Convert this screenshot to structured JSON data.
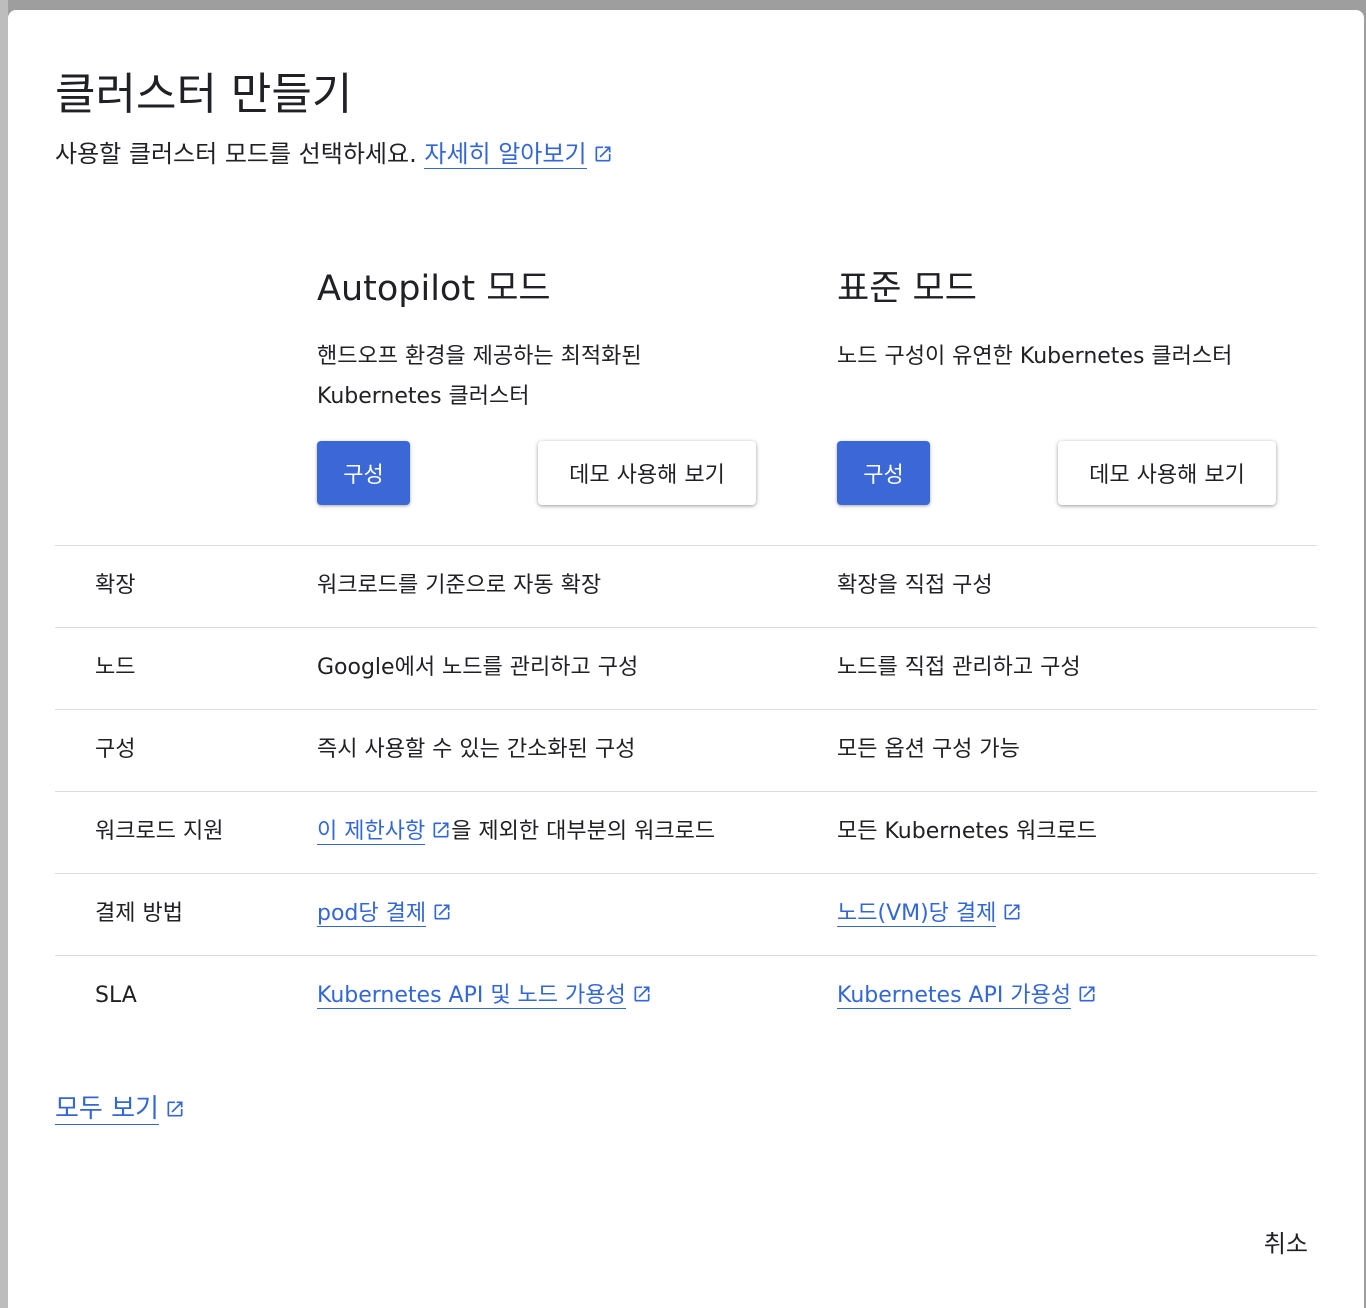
{
  "dialog": {
    "title": "클러스터 만들기",
    "subtitle_text": "사용할 클러스터 모드를 선택하세요.",
    "learn_more": "자세히 알아보기"
  },
  "modes": {
    "autopilot": {
      "title": "Autopilot 모드",
      "desc_line1": "핸드오프 환경을 제공하는 최적화된",
      "desc_line2": "Kubernetes 클러스터",
      "configure_label": "구성",
      "demo_label": "데모 사용해 보기"
    },
    "standard": {
      "title": "표준 모드",
      "desc_line1": "노드 구성이 유연한 Kubernetes 클러스터",
      "configure_label": "구성",
      "demo_label": "데모 사용해 보기"
    }
  },
  "rows": [
    {
      "label": "확장",
      "autopilot": "워크로드를 기준으로 자동 확장",
      "standard": "확장을 직접 구성"
    },
    {
      "label": "노드",
      "autopilot": "Google에서 노드를 관리하고 구성",
      "standard": "노드를 직접 관리하고 구성"
    },
    {
      "label": "구성",
      "autopilot": "즉시 사용할 수 있는 간소화된 구성",
      "standard": "모든 옵션 구성 가능"
    },
    {
      "label": "워크로드 지원",
      "autopilot_link": "이 제한사항",
      "autopilot_suffix": "을 제외한 대부분의 워크로드",
      "standard": "모든 Kubernetes 워크로드"
    },
    {
      "label": "결제 방법",
      "autopilot_link": "pod당 결제",
      "standard_link": "노드(VM)당 결제"
    },
    {
      "label": "SLA",
      "autopilot_link": "Kubernetes API 및 노드 가용성",
      "standard_link": "Kubernetes API 가용성"
    }
  ],
  "footer": {
    "view_all": "모두 보기",
    "cancel": "취소"
  },
  "colors": {
    "primary_button": "#3c67d6",
    "link": "#3367d6",
    "divider": "#dadce0"
  }
}
